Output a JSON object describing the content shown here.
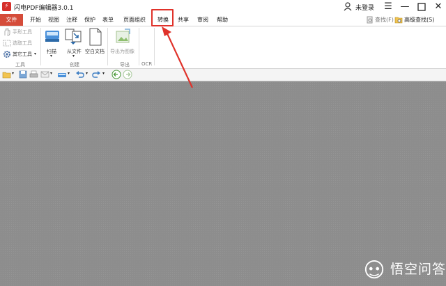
{
  "window": {
    "title": "闪电PDF编辑器3.0.1",
    "user_label": "未登录",
    "controls": [
      "menu-icon",
      "minimize-icon",
      "maximize-icon",
      "close-icon"
    ]
  },
  "menu": {
    "file": "文件",
    "tabs": [
      "开始",
      "视图",
      "注释",
      "保护",
      "表单",
      "页面组织",
      "转换",
      "共享",
      "审阅",
      "帮助"
    ],
    "search_label": "查找(F)",
    "advanced_search_label": "高级查找(S)"
  },
  "ribbon": {
    "tools": {
      "hand_tool": "手形工具",
      "select_tool": "选取工具",
      "other_tools": "其它工具",
      "group_label": "工具"
    },
    "create": {
      "scan": "扫描",
      "from_file": "从文件",
      "blank_doc": "空白文档",
      "group_label": "创建"
    },
    "export": {
      "export_image": "导出为图像",
      "group_label": "导出"
    },
    "ocr": {
      "group_label": "OCR"
    }
  },
  "colors": {
    "accent": "#d54c3a",
    "highlight": "#e0322a",
    "document_bg": "#8d8d8d"
  },
  "watermark": {
    "text": "悟空问答"
  }
}
